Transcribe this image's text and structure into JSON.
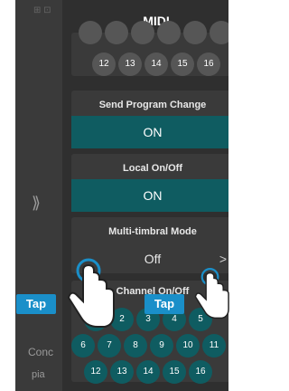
{
  "panel": {
    "title": "MIDI"
  },
  "background": {
    "concert_text": "Conc",
    "piano_text": "pia"
  },
  "top_channels": [
    "12",
    "13",
    "14",
    "15",
    "16"
  ],
  "send_program_change": {
    "label": "Send Program Change",
    "value": "ON"
  },
  "local_on_off": {
    "label": "Local On/Off",
    "value": "ON"
  },
  "multi_timbral_mode": {
    "label": "Multi-timbral Mode",
    "value": "Off"
  },
  "channel_on_off": {
    "label": "Channel On/Off",
    "row1": [
      "1",
      "2",
      "3",
      "4",
      "5"
    ],
    "row2": [
      "6",
      "7",
      "8",
      "9",
      "10",
      "11"
    ],
    "row3": [
      "12",
      "13",
      "14",
      "15",
      "16"
    ]
  },
  "annotations": {
    "tap_left": "Tap",
    "tap_right": "Tap"
  },
  "colors": {
    "accent": "#0f5c61",
    "tap_badge": "#1a8fc9"
  }
}
